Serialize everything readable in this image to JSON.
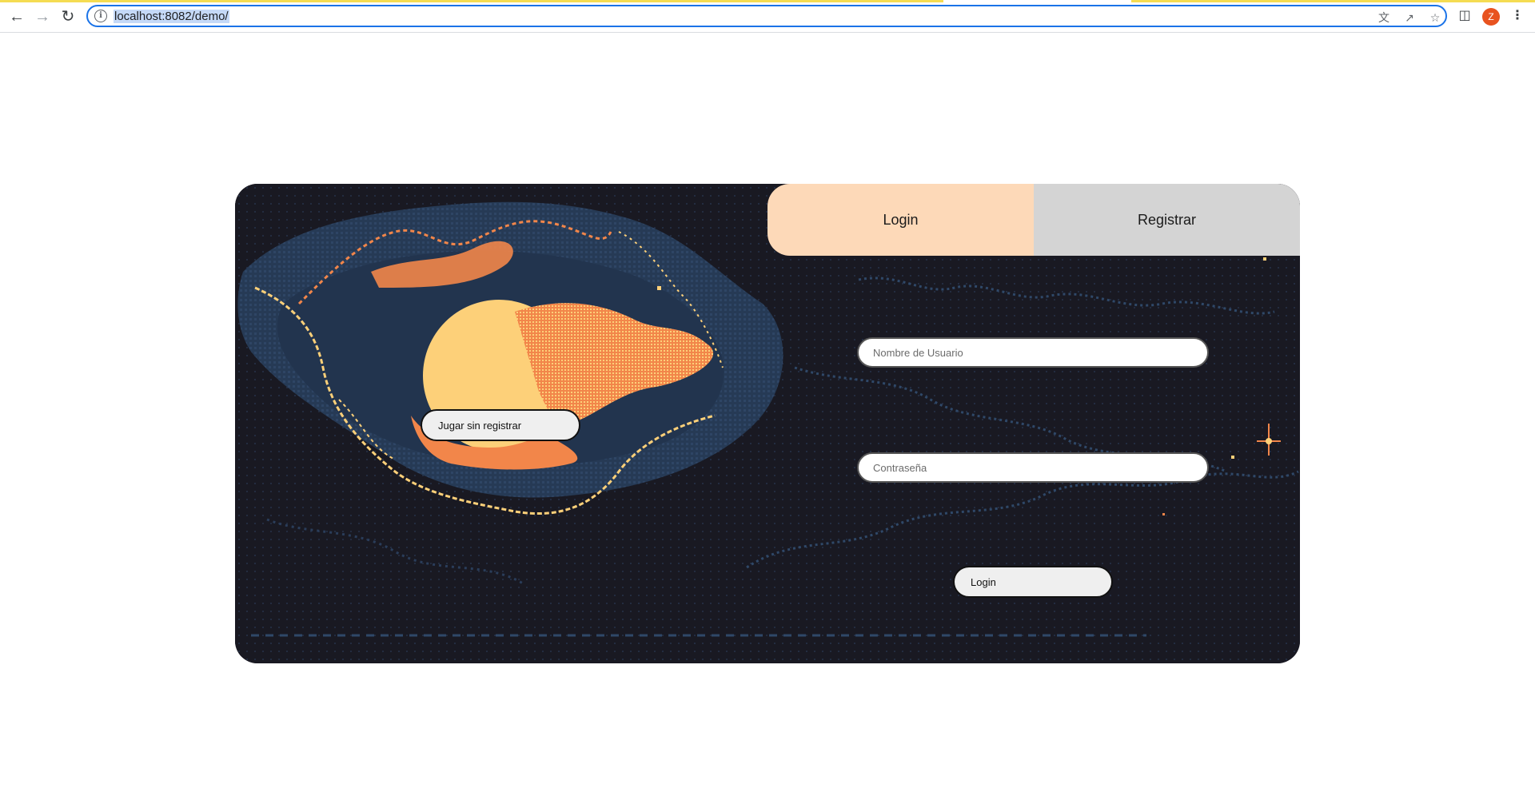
{
  "browser": {
    "url": "localhost:8082/demo/",
    "avatar_letter": "Z",
    "icons": {
      "back": "arrow-left-icon",
      "forward": "arrow-right-icon",
      "reload": "reload-icon",
      "info": "info-icon",
      "translate": "translate-icon",
      "share": "share-icon",
      "bookmark": "star-icon",
      "side_panel": "side-panel-icon",
      "menu": "kebab-menu-icon"
    }
  },
  "tabs": {
    "login_label": "Login",
    "register_label": "Registrar"
  },
  "form": {
    "username_placeholder": "Nombre de Usuario",
    "password_placeholder": "Contraseña",
    "login_button": "Login"
  },
  "guest_button": "Jugar sin registrar",
  "colors": {
    "card_background": "#191922",
    "tab_active": "#fdd9b8",
    "tab_inactive": "#d4d4d4",
    "planet": "#fdd079",
    "flare": "#f2864a",
    "nebula": "#263a55"
  }
}
